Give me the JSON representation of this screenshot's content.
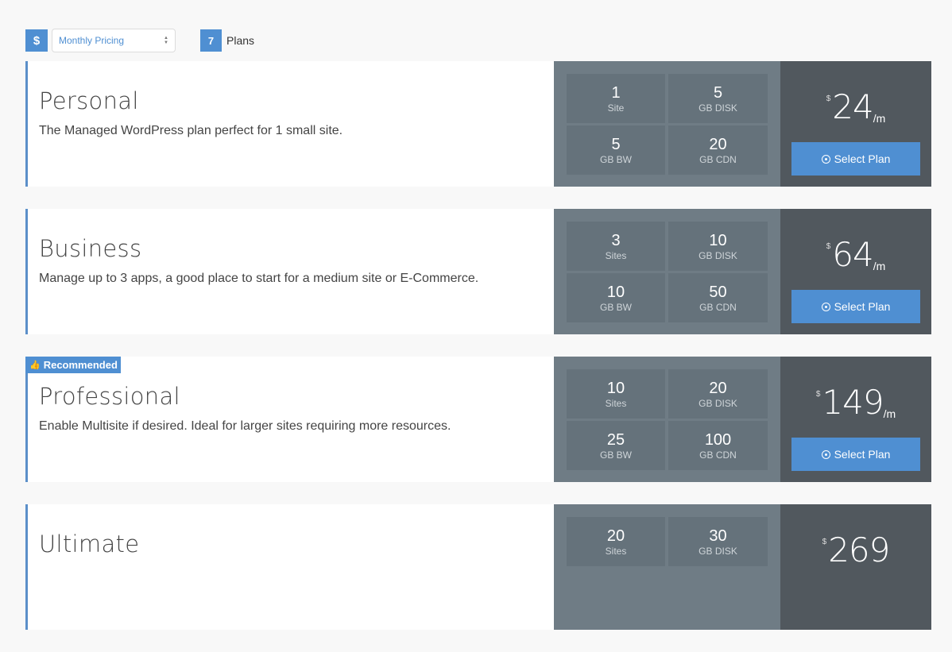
{
  "toolbar": {
    "currency_icon": "$",
    "pricing_select": {
      "value": "Monthly Pricing"
    },
    "plans_count": "7",
    "plans_label": "Plans"
  },
  "plans": [
    {
      "name": "Personal",
      "description": "The Managed WordPress plan perfect for 1 small site.",
      "recommended": false,
      "specs": [
        {
          "value": "1",
          "unit": "Site"
        },
        {
          "value": "5",
          "unit": "GB DISK"
        },
        {
          "value": "5",
          "unit": "GB BW"
        },
        {
          "value": "20",
          "unit": "GB CDN"
        }
      ],
      "price": {
        "currency": "$",
        "amount": "24",
        "period": "/m"
      },
      "button_label": "Select Plan"
    },
    {
      "name": "Business",
      "description": "Manage up to 3 apps, a good place to start for a medium site or E-Commerce.",
      "recommended": false,
      "specs": [
        {
          "value": "3",
          "unit": "Sites"
        },
        {
          "value": "10",
          "unit": "GB DISK"
        },
        {
          "value": "10",
          "unit": "GB BW"
        },
        {
          "value": "50",
          "unit": "GB CDN"
        }
      ],
      "price": {
        "currency": "$",
        "amount": "64",
        "period": "/m"
      },
      "button_label": "Select Plan"
    },
    {
      "name": "Professional",
      "description": "Enable Multisite if desired. Ideal for larger sites requiring more resources.",
      "recommended": true,
      "recommended_label": "Recommended",
      "specs": [
        {
          "value": "10",
          "unit": "Sites"
        },
        {
          "value": "20",
          "unit": "GB DISK"
        },
        {
          "value": "25",
          "unit": "GB BW"
        },
        {
          "value": "100",
          "unit": "GB CDN"
        }
      ],
      "price": {
        "currency": "$",
        "amount": "149",
        "period": "/m"
      },
      "button_label": "Select Plan"
    },
    {
      "name": "Ultimate",
      "description": "",
      "recommended": false,
      "specs": [
        {
          "value": "20",
          "unit": "Sites"
        },
        {
          "value": "30",
          "unit": "GB DISK"
        }
      ],
      "price": {
        "currency": "$",
        "amount": "269",
        "period": ""
      },
      "button_label": ""
    }
  ],
  "colors": {
    "accent": "#4f8fd2",
    "specs_bg": "#6f7c85",
    "spec_cell_bg": "#65727b",
    "price_bg": "#51585e",
    "page_bg": "#f8f8f8"
  }
}
